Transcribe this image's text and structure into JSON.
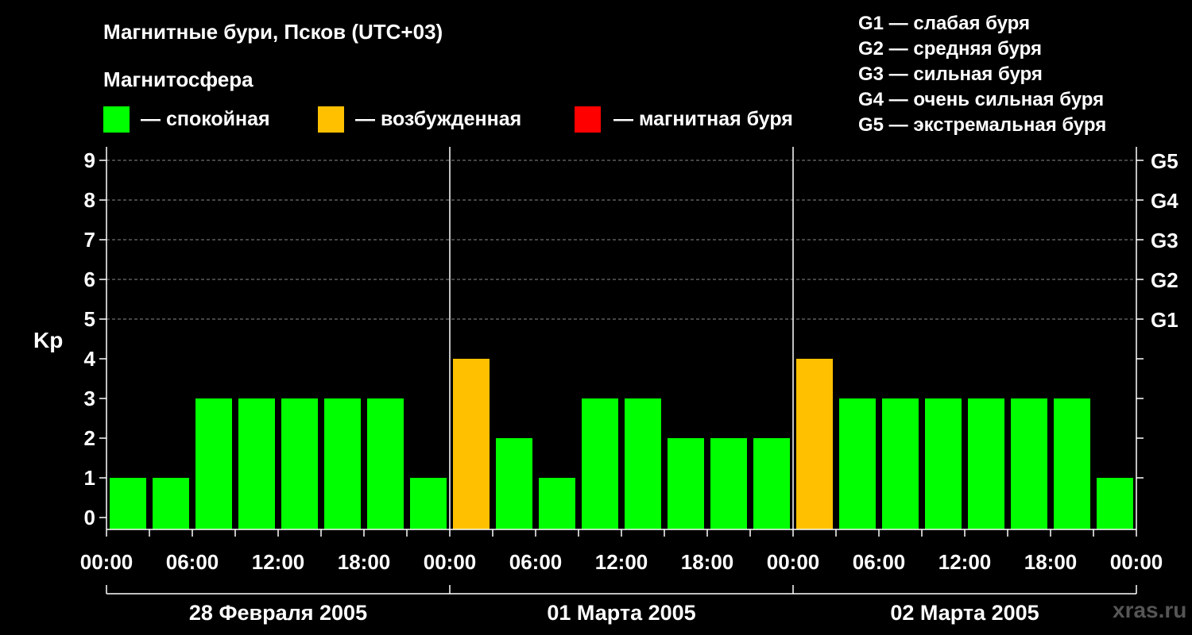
{
  "chart_data": {
    "type": "bar",
    "title": "Магнитные бури, Псков (UTC+03)",
    "legend": {
      "title": "Магнитосфера",
      "items": [
        {
          "key": "quiet",
          "label": "— спокойная",
          "color": "#00ff00"
        },
        {
          "key": "excited",
          "label": "— возбужденная",
          "color": "#ffc000"
        },
        {
          "key": "storm",
          "label": "— магнитная буря",
          "color": "#ff0000"
        }
      ],
      "placement": "top"
    },
    "g_scale_legend": [
      "G1 — слабая буря",
      "G2 — средняя буря",
      "G3 — сильная буря",
      "G4 — очень сильная буря",
      "G5 — экстремальная буря"
    ],
    "ylabel": "Kp",
    "ylim": [
      0,
      9
    ],
    "y_ticks": [
      "0",
      "1",
      "2",
      "3",
      "4",
      "5",
      "6",
      "7",
      "8",
      "9"
    ],
    "right_ticks": [
      {
        "value": 5,
        "label": "G1"
      },
      {
        "value": 6,
        "label": "G2"
      },
      {
        "value": 7,
        "label": "G3"
      },
      {
        "value": 8,
        "label": "G4"
      },
      {
        "value": 9,
        "label": "G5"
      }
    ],
    "grid": "dashed horizontal at Kp 5–9",
    "x_tick_labels": [
      "00:00",
      "06:00",
      "12:00",
      "18:00",
      "00:00",
      "06:00",
      "12:00",
      "18:00",
      "00:00",
      "06:00",
      "12:00",
      "18:00",
      "00:00"
    ],
    "days": [
      "28 Февраля 2005",
      "01 Марта 2005",
      "02 Марта 2005"
    ],
    "intervals_per_day": 8,
    "values": [
      1,
      1,
      3,
      3,
      3,
      3,
      3,
      1,
      4,
      2,
      1,
      3,
      3,
      2,
      2,
      2,
      4,
      3,
      3,
      3,
      3,
      3,
      3,
      1
    ],
    "status": [
      "quiet",
      "quiet",
      "quiet",
      "quiet",
      "quiet",
      "quiet",
      "quiet",
      "quiet",
      "excited",
      "quiet",
      "quiet",
      "quiet",
      "quiet",
      "quiet",
      "quiet",
      "quiet",
      "excited",
      "quiet",
      "quiet",
      "quiet",
      "quiet",
      "quiet",
      "quiet",
      "quiet"
    ]
  },
  "watermark": "xras.ru"
}
